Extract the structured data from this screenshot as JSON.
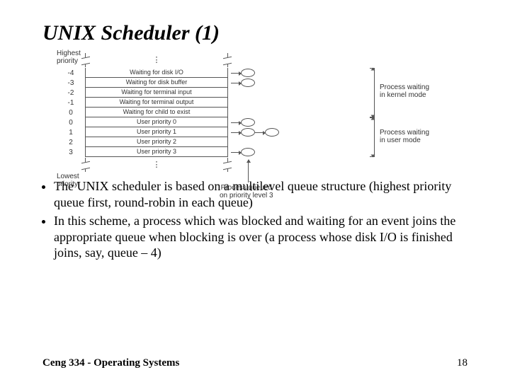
{
  "title": "UNIX Scheduler (1)",
  "diagram": {
    "top_label": "Highest\npriority",
    "bottom_label": "Lowest\npriority",
    "rows": [
      {
        "num": "-4",
        "label": "Waiting for disk I/O",
        "nodes": 1
      },
      {
        "num": "-3",
        "label": "Waiting for disk buffer",
        "nodes": 1
      },
      {
        "num": "-2",
        "label": "Waiting for terminal input",
        "nodes": 0
      },
      {
        "num": "-1",
        "label": "Waiting for terminal output",
        "nodes": 0
      },
      {
        "num": "0",
        "label": "Waiting for child to exist",
        "nodes": 0
      },
      {
        "num": "0",
        "label": "User priority 0",
        "nodes": 1
      },
      {
        "num": "1",
        "label": "User priority 1",
        "nodes": 2
      },
      {
        "num": "2",
        "label": "User priority 2",
        "nodes": 0
      },
      {
        "num": "3",
        "label": "User priority 3",
        "nodes": 1
      }
    ],
    "process_queued_label": "Process queued\non priority level 3",
    "right_upper_label": "Process waiting\nin kernel mode",
    "right_lower_label": "Process waiting\nin user mode"
  },
  "bullets": [
    "The UNIX scheduler is based on a multilevel queue structure (highest priority queue first, round-robin in each queue)",
    "In this scheme, a process which was blocked and waiting for an event joins the appropriate queue when blocking is over (a process whose disk I/O is finished joins, say, queue – 4)"
  ],
  "footer": {
    "left": "Ceng 334 - Operating Systems",
    "right": "18"
  }
}
